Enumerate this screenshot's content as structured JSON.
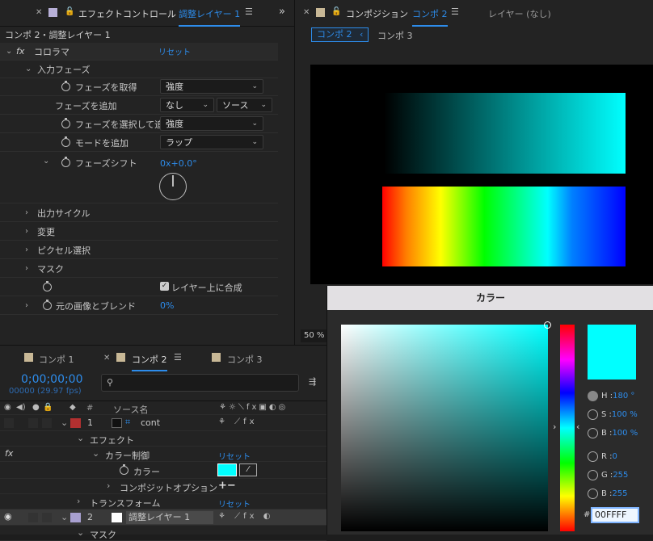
{
  "effect_panel": {
    "tab_label": "エフェクトコントロール",
    "tab_layer": "調整レイヤー 1",
    "breadcrumb": "コンポ 2・調整レイヤー 1",
    "effect_name": "コロラマ",
    "reset_label": "リセット",
    "rows": {
      "input_phase": "入力フェーズ",
      "get_phase": "フェーズを取得",
      "get_phase_value": "強度",
      "add_phase": "フェーズを追加",
      "add_phase_value": "なし",
      "add_phase_source": "ソース",
      "select_phase": "フェーズを選択して追",
      "select_phase_value": "強度",
      "add_mode": "モードを追加",
      "add_mode_value": "ラップ",
      "phase_shift": "フェーズシフト",
      "phase_shift_value": "0x+0.0°",
      "output_cycle": "出力サイクル",
      "modify": "変更",
      "pixel_select": "ピクセル選択",
      "mask": "マスク",
      "composite_label": "レイヤー上に合成",
      "blend_original": "元の画像とブレンド",
      "blend_value": "0%"
    }
  },
  "viewer": {
    "tab_label": "コンポジション",
    "tab_comp": "コンポ 2",
    "layer_tab": "レイヤー (なし)",
    "crumb_active": "コンポ 2",
    "crumb_other": "コンポ 3",
    "zoom": "50 %"
  },
  "timeline": {
    "tabs": [
      "コンポ 1",
      "コンポ 2",
      "コンポ 3"
    ],
    "timecode": "0;00;00;00",
    "frames": "00000 (29.97 fps)",
    "search_placeholder": "",
    "col_hash": "#",
    "col_source": "ソース名",
    "layer1_num": "1",
    "layer1_name": "cont",
    "effect_group": "エフェクト",
    "color_control": "カラー制御",
    "reset_label": "リセット",
    "color_label": "カラー",
    "composite_options": "コンポジットオプション",
    "plus_minus": "+−",
    "transform": "トランスフォーム",
    "layer2_num": "2",
    "layer2_name": "調整レイヤー 1",
    "mask": "マスク"
  },
  "picker": {
    "title": "カラー",
    "h_label": "H",
    "h_value": "180 °",
    "s_label": "S",
    "s_value": "100 %",
    "b_label": "B",
    "b_value": "100 %",
    "r_label": "R",
    "r_value": "0",
    "g_label": "G",
    "g_value": "255",
    "b2_label": "B",
    "b2_value": "255",
    "hash": "#",
    "hex_value": "00FFFF",
    "current_color": "#00ffff"
  },
  "colors": {
    "accent": "#2d8ceb",
    "layer1_label": "#b33030",
    "layer2_label": "#a8a0d0"
  }
}
